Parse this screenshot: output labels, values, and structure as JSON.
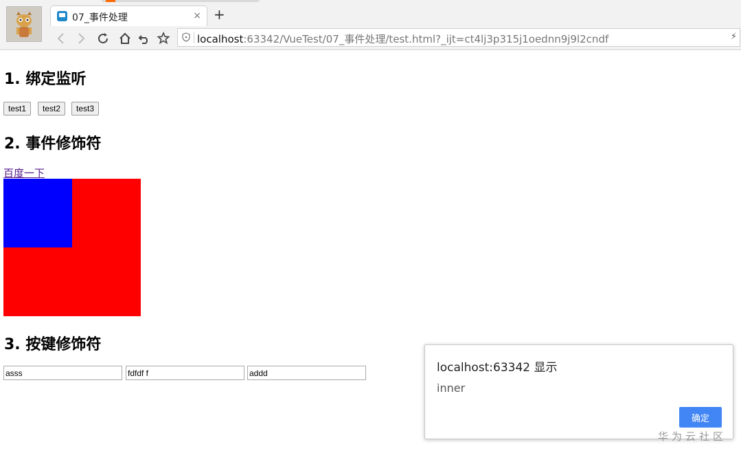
{
  "browser": {
    "tab_title": "07_事件处理",
    "tab_close": "×",
    "new_tab": "+",
    "address": {
      "host": "localhost",
      "rest": ":63342/VueTest/07_事件处理/test.html?_ijt=ct4lj3p315j1oednn9j9l2cndf"
    }
  },
  "page": {
    "section1_title": "1. 绑定监听",
    "buttons": [
      "test1",
      "test2",
      "test3"
    ],
    "section2_title": "2. 事件修饰符",
    "link_text": "百度一下",
    "section3_title": "3. 按键修饰符",
    "inputs": [
      "asss",
      "fdfdf f",
      "addd"
    ],
    "colors": {
      "outer_box": "#ff0000",
      "inner_box": "#0000ff"
    }
  },
  "dialog": {
    "title": "localhost:63342 显示",
    "message": "inner",
    "ok_label": "确定",
    "ok_color": "#4285f4"
  },
  "watermark": "华为云社区"
}
